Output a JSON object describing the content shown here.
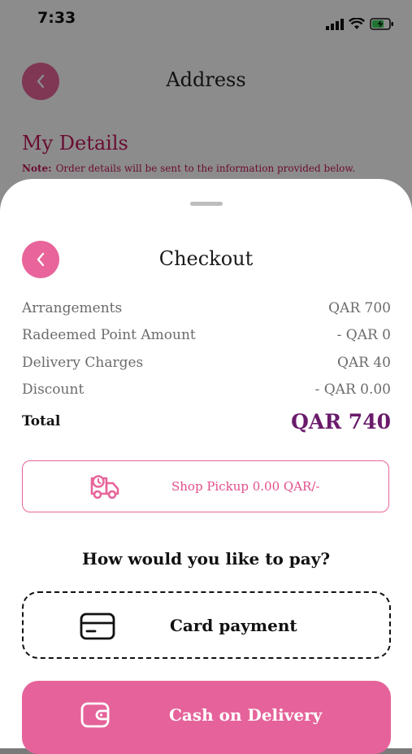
{
  "status_bar": {
    "time": "7:33"
  },
  "background_screen": {
    "title": "Address",
    "details_title": "My Details",
    "note_label": "Note:",
    "note_text": "Order details will be sent to the information provided below."
  },
  "checkout": {
    "title": "Checkout",
    "rows": [
      {
        "label": "Arrangements",
        "value": "QAR 700"
      },
      {
        "label": "Radeemed Point Amount",
        "value": "-  QAR 0"
      },
      {
        "label": "Delivery Charges",
        "value": "QAR 40"
      },
      {
        "label": "Discount",
        "value": "-  QAR 0.00"
      }
    ],
    "total_label": "Total",
    "total_value": "QAR 740",
    "pickup_text": "Shop Pickup 0.00 QAR/-",
    "pay_question": "How would you like to pay?",
    "card_payment": "Card payment",
    "cash_on_delivery": "Cash on Delivery"
  },
  "colors": {
    "accent_pink": "#e8649a",
    "total_purple": "#6a1b6b"
  },
  "icons": [
    "chevron-left-icon",
    "signal-icon",
    "wifi-icon",
    "battery-icon",
    "delivery-truck-icon",
    "credit-card-icon",
    "wallet-icon"
  ]
}
